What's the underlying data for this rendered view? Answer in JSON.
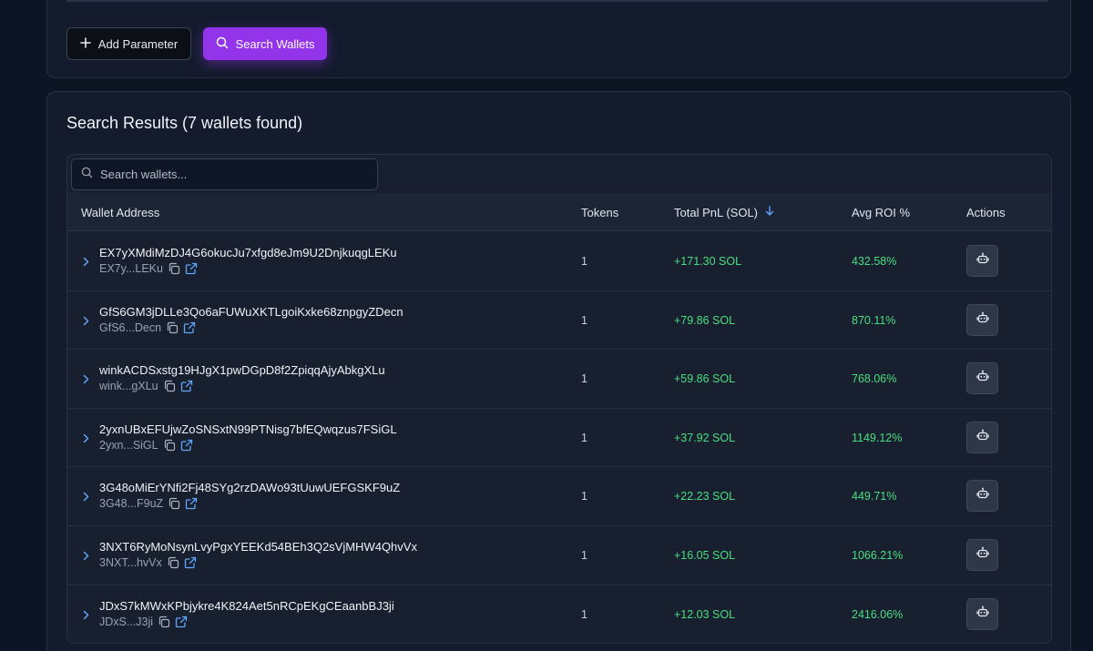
{
  "toolbar": {
    "add_parameter_label": "Add Parameter",
    "search_wallets_label": "Search Wallets"
  },
  "results": {
    "title": "Search Results (7 wallets found)",
    "search_placeholder": "Search wallets...",
    "columns": {
      "wallet_address": "Wallet Address",
      "tokens": "Tokens",
      "total_pnl": "Total PnL (SOL)",
      "avg_roi": "Avg ROI %",
      "actions": "Actions"
    },
    "sort": {
      "column": "total_pnl",
      "direction": "descending"
    },
    "rows": [
      {
        "address": "EX7yXMdiMzDJ4G6okucJu7xfgd8eJm9U2DnjkuqgLEKu",
        "short": "EX7y...LEKu",
        "tokens": "1",
        "pnl": "+171.30 SOL",
        "roi": "432.58%"
      },
      {
        "address": "GfS6GM3jDLLe3Qo6aFUWuXKTLgoiKxke68znpgyZDecn",
        "short": "GfS6...Decn",
        "tokens": "1",
        "pnl": "+79.86 SOL",
        "roi": "870.11%"
      },
      {
        "address": "winkACDSxstg19HJgX1pwDGpD8f2ZpiqqAjyAbkgXLu",
        "short": "wink...gXLu",
        "tokens": "1",
        "pnl": "+59.86 SOL",
        "roi": "768.06%"
      },
      {
        "address": "2yxnUBxEFUjwZoSNSxtN99PTNisg7bfEQwqzus7FSiGL",
        "short": "2yxn...SiGL",
        "tokens": "1",
        "pnl": "+37.92 SOL",
        "roi": "1149.12%"
      },
      {
        "address": "3G48oMiErYNfi2Fj48SYg2rzDAWo93tUuwUEFGSKF9uZ",
        "short": "3G48...F9uZ",
        "tokens": "1",
        "pnl": "+22.23 SOL",
        "roi": "449.71%"
      },
      {
        "address": "3NXT6RyMoNsynLvyPgxYEEKd54BEh3Q2sVjMHW4QhvVx",
        "short": "3NXT...hvVx",
        "tokens": "1",
        "pnl": "+16.05 SOL",
        "roi": "1066.21%"
      },
      {
        "address": "JDxS7kMWxKPbjykre4K824Aet5nRCpEKgCEaanbBJ3ji",
        "short": "JDxS...J3ji",
        "tokens": "1",
        "pnl": "+12.03 SOL",
        "roi": "2416.06%"
      }
    ]
  },
  "colors": {
    "accent": "#9333ea",
    "positive": "#4ade80",
    "sort_arrow": "#60a5fa",
    "link_icon": "#60a5fa"
  },
  "icons": {
    "add": "plus-icon",
    "search": "search-icon",
    "expand": "chevron-right-icon",
    "copy": "copy-icon",
    "external": "external-link-icon",
    "action": "bot-icon",
    "sort": "arrow-down-icon"
  }
}
